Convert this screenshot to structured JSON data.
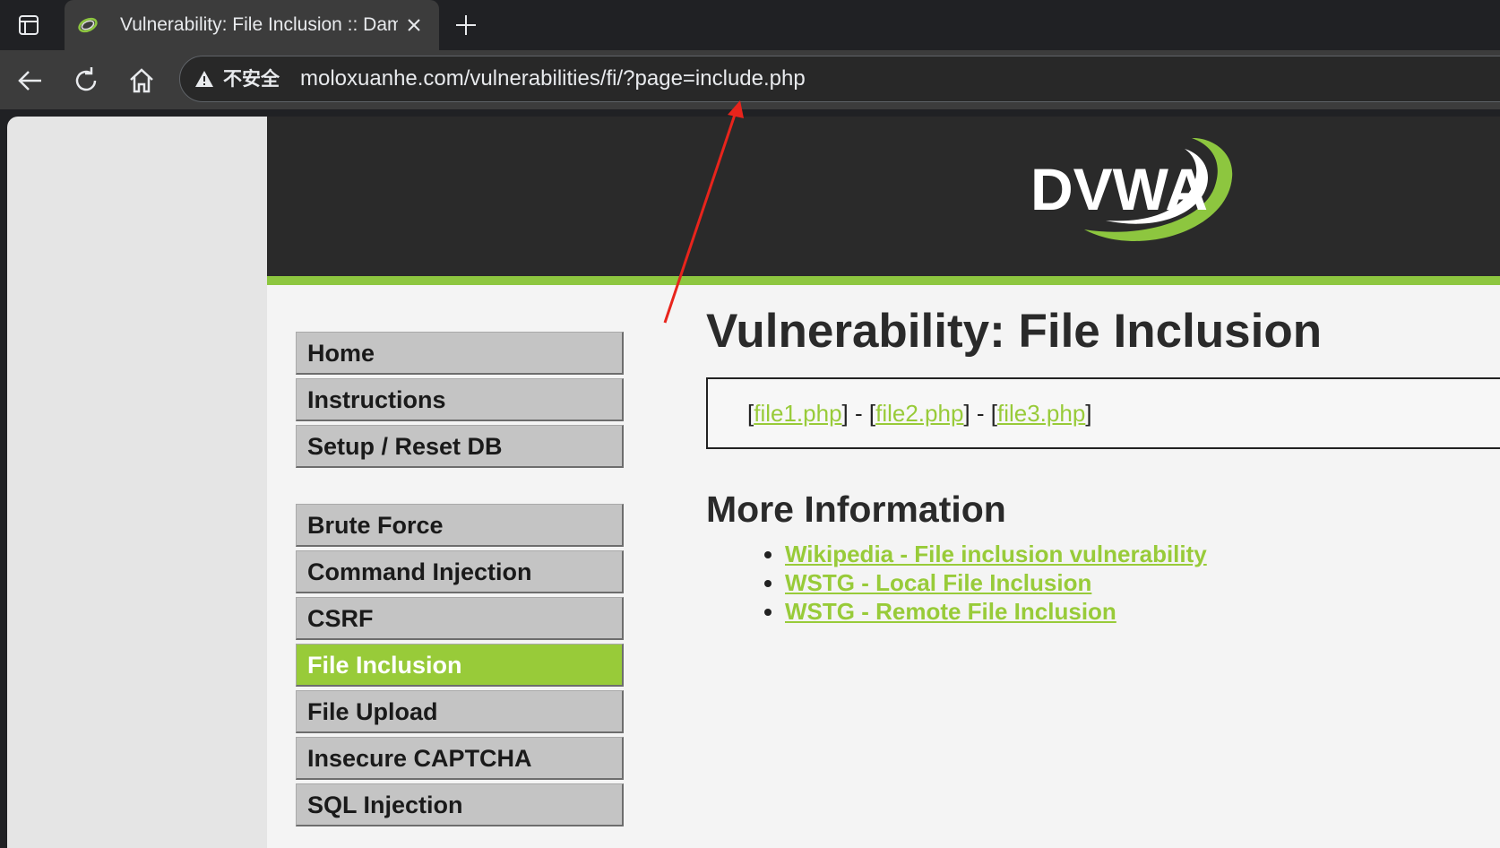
{
  "browser": {
    "tab_title": "Vulnerability: File Inclusion :: Damn Vulnerable Web Application",
    "security_label": "不安全",
    "url": "moloxuanhe.com/vulnerabilities/fi/?page=include.php"
  },
  "header": {
    "logo_text": "DVWA"
  },
  "menu": {
    "group1": [
      "Home",
      "Instructions",
      "Setup / Reset DB"
    ],
    "group2": [
      "Brute Force",
      "Command Injection",
      "CSRF",
      "File Inclusion",
      "File Upload",
      "Insecure CAPTCHA",
      "SQL Injection"
    ],
    "selected": "File Inclusion"
  },
  "main": {
    "title": "Vulnerability: File Inclusion",
    "files": [
      "file1.php",
      "file2.php",
      "file3.php"
    ],
    "more_title": "More Information",
    "links": [
      "Wikipedia - File inclusion vulnerability",
      "WSTG - Local File Inclusion",
      "WSTG - Remote File Inclusion"
    ]
  },
  "colors": {
    "accent_green": "#98cb39",
    "header_dark": "#2a2a2a",
    "arrow_red": "#e8241c"
  }
}
